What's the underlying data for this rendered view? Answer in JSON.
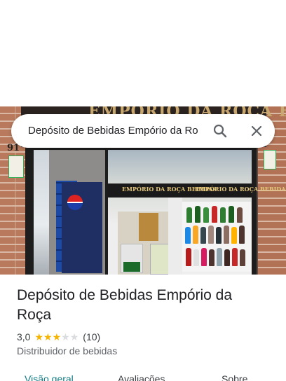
{
  "search": {
    "query": "Depósito de Bebidas Empório da Ro",
    "search_icon": "search-icon",
    "close_icon": "close-icon"
  },
  "photo": {
    "banner_text": "EMPÓRIO DA ROÇA BEBIDAS",
    "sign_left": "EMPÓRIO DA ROÇA BEBIDAS",
    "sign_right": "EMPÓRIO DA ROÇA BEBIDAS",
    "number": "91"
  },
  "place": {
    "title": "Depósito de Bebidas Empório da Roça",
    "rating": "3,0",
    "stars_filled": 3,
    "stars_total": 5,
    "review_count": "(10)",
    "category": "Distribuidor de bebidas"
  },
  "tabs": [
    {
      "label": "Visão geral",
      "active": true
    },
    {
      "label": "Avaliações",
      "active": false
    },
    {
      "label": "Sobre",
      "active": false
    }
  ],
  "colors": {
    "star": "#f4b400",
    "active_tab": "#0f7c85"
  }
}
